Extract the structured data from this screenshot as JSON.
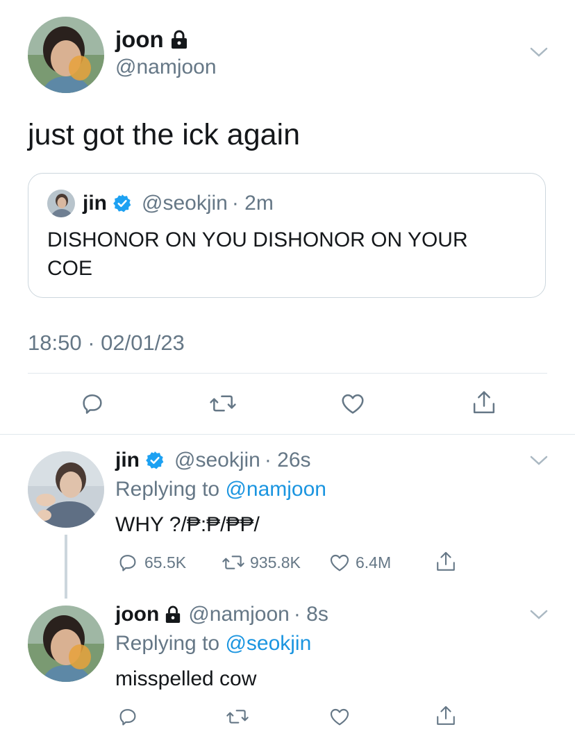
{
  "main_tweet": {
    "author_name": "joon",
    "author_handle": "@namjoon",
    "text": "just got the ick again",
    "timestamp": "18:50 · 02/01/23",
    "quoted": {
      "author_name": "jin",
      "author_handle": "@seokjin",
      "time": "· 2m",
      "text_line1": "DISHONOR ON YOU DISHONOR ON YOUR",
      "text_line2": "COE"
    }
  },
  "replies": [
    {
      "author_name": "jin",
      "author_handle": "@seokjin",
      "time": "· 26s",
      "replying_prefix": "Replying to",
      "replying_to": "@namjoon",
      "text": "WHY ?/₱:₱/₱₱/",
      "reply_count": "65.5K",
      "retweet_count": "935.8K",
      "like_count": "6.4M"
    },
    {
      "author_name": "joon",
      "author_handle": "@namjoon",
      "time": "· 8s",
      "replying_prefix": "Replying to",
      "replying_to": "@seokjin",
      "text": "misspelled cow"
    }
  ],
  "icons": [
    "lock-icon",
    "verified-icon",
    "chevron-down-icon",
    "reply-icon",
    "retweet-icon",
    "like-icon",
    "share-icon"
  ],
  "colors": {
    "link": "#1b95e0",
    "verified": "#1da1f2",
    "secondary": "#657786",
    "divider": "#e1e8ed"
  }
}
